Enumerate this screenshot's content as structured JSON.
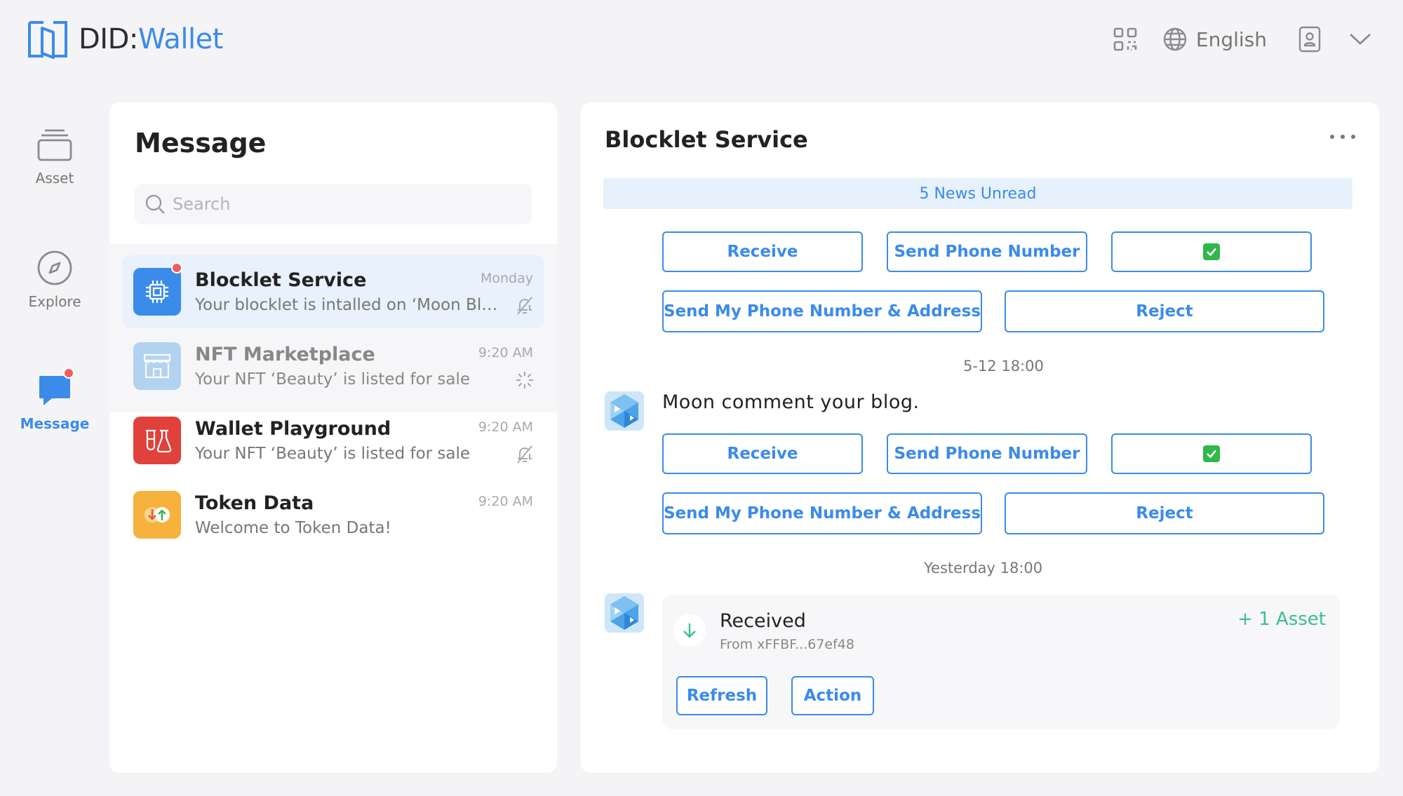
{
  "brand": {
    "did": "DID",
    "colon": ":",
    "wallet": "Wallet"
  },
  "header": {
    "language": "English",
    "icons": [
      "qr-code-icon",
      "globe-icon",
      "contact-icon",
      "chevron-down-icon"
    ]
  },
  "rail": [
    {
      "label": "Asset",
      "icon": "stack-icon",
      "active": false
    },
    {
      "label": "Explore",
      "icon": "compass-icon",
      "active": false
    },
    {
      "label": "Message",
      "icon": "chat-bubble-icon",
      "active": true,
      "has_dot": true
    }
  ],
  "messages_panel": {
    "title": "Message",
    "search_placeholder": "Search",
    "conversations": [
      {
        "name": "Blocklet Service",
        "preview": "Your blocklet is intalled on ‘Moon Blocklet Server’",
        "time": "Monday",
        "selected": true,
        "unread_dot": true,
        "icon": "chip-icon",
        "color": "#3b8bea",
        "status_icon": "bell-off-icon"
      },
      {
        "name": "NFT Marketplace",
        "preview": "Your NFT ‘Beauty’ is listed for sale",
        "time": "9:20 AM",
        "icon": "store-icon",
        "color": "#79b7ea",
        "status_icon": "loading-icon"
      },
      {
        "name": "Wallet Playground",
        "preview": "Your NFT ‘Beauty’ is listed for sale",
        "time": "9:20 AM",
        "icon": "lab-icon",
        "color": "#e0413a",
        "status_icon": "bell-off-icon"
      },
      {
        "name": "Token Data",
        "preview": "Welcome to Token Data!",
        "time": "9:20 AM",
        "icon": "token-swap-icon",
        "color": "#f6b23c"
      }
    ]
  },
  "chat": {
    "title": "Blocklet Service",
    "unread_banner": "5 News Unread",
    "buttons": {
      "receive": "Receive",
      "send_phone": "Send Phone Number",
      "send_address": "Send My Phone Number & Address",
      "reject": "Reject"
    },
    "groups": [
      {
        "timestamp": "",
        "text": ""
      },
      {
        "timestamp": "5-12 18:00",
        "text": "Moon comment your blog."
      }
    ],
    "received": {
      "timestamp": "Yesterday 18:00",
      "title": "Received",
      "from": "From xFFBF...67ef48",
      "amount": "+ 1 Asset",
      "refresh": "Refresh",
      "action": "Action"
    }
  },
  "colors": {
    "accent": "#3b8bea",
    "success": "#3cbf92",
    "danger": "#f25d5d",
    "background": "#f4f4f7"
  }
}
